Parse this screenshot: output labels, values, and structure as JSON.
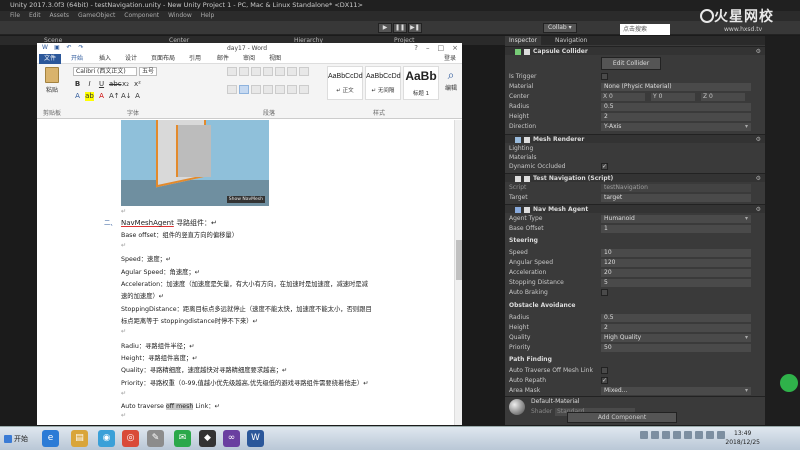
{
  "unity": {
    "title": "Unity 2017.3.0f3 (64bit) - testNavigation.unity - New Unity Project 1 - PC, Mac & Linux Standalone* <DX11>",
    "menu": [
      "File",
      "Edit",
      "Assets",
      "GameObject",
      "Component",
      "Window",
      "Help"
    ],
    "collab": "Collab ▾",
    "tabs": {
      "scene": "Scene",
      "hierarchy": "Hierarchy",
      "project": "Project",
      "center": "Center"
    },
    "search_overlay": "点击搜索"
  },
  "watermark": {
    "title": "火星网校",
    "url": "www.hxsd.tv"
  },
  "word": {
    "doc_title": "day17 - Word",
    "ribbon_tabs": [
      "文件",
      "开始",
      "插入",
      "设计",
      "页面布局",
      "引用",
      "邮件",
      "审阅",
      "视图"
    ],
    "login": "登录",
    "paste": "粘贴",
    "clipboard": "剪贴板",
    "font_name": "Calibri (西文正文)",
    "font_size": "五号",
    "font_group": "字体",
    "para_group": "段落",
    "styles_group": "样式",
    "styles": [
      {
        "sample": "AaBbCcDd",
        "name": "↵ 正文"
      },
      {
        "sample": "AaBbCcDd",
        "name": "↵ 无间隔"
      },
      {
        "sample": "AaBb",
        "name": "标题 1"
      }
    ],
    "edit": "编辑",
    "shot_label": "Show NavMesh",
    "lines": {
      "heading_num": "二、",
      "heading": "NavMeshAgent",
      "heading_rest": "寻路组件：↵",
      "base_offset": "Base offset：组件的竖直方向的偏移量）",
      "blank1": "↵",
      "speed": "Speed：速度；↵",
      "angular": "Agular Speed：角速度；↵",
      "accel1": "Acceleration：加速度（加速度是矢量，有大小有方向，在加速时是加速度，减速时是减",
      "accel2": "速的加速度）↵",
      "stop1": "StoppingDistance：距离目标点多远就停止（速度不能太快，加速度不能太小，否则跟目",
      "stop2": "标点距离等于 stoppingdistance时停不下来）↵",
      "blank2": "↵",
      "radius": "Radiu：寻路组件半径；↵",
      "height": "Height：寻路组件高度；↵",
      "quality": "Quality：寻路精细度，速度越快对寻路精细度要求越高；↵",
      "priority": "Priority：寻路权重（0-99,值越小优先级越高,优先级低的避戏寻路组件需要绕着他走）↵",
      "blank3": "↵",
      "auto_pre": "Auto traverse ",
      "auto_hl": "off mesh",
      "auto_post": " Link：↵",
      "blank4": "↵",
      "blank5": "↵"
    }
  },
  "inspector": {
    "tabs": [
      "Inspector",
      "Navigation"
    ],
    "capsule": {
      "header": "Capsule Collider",
      "edit_collider": "Edit Collider",
      "props": [
        {
          "label": "Is Trigger",
          "type": "check",
          "value": ""
        },
        {
          "label": "Material",
          "type": "field",
          "value": "None (Physic Material)"
        },
        {
          "label": "Radius",
          "type": "field",
          "value": "0.5"
        },
        {
          "label": "Height",
          "type": "field",
          "value": "2"
        },
        {
          "label": "Direction",
          "type": "dd",
          "value": "Y-Axis"
        }
      ],
      "center_label": "Center",
      "center": [
        "X 0",
        "Y 0",
        "Z 0"
      ]
    },
    "mesh_renderer": {
      "header": "Mesh Renderer",
      "lighting": "Lighting",
      "materials": "Materials",
      "occluded": "Dynamic Occluded",
      "occluded_check": "✓"
    },
    "test_nav": {
      "header": "Test Navigation (Script)",
      "script_label": "Script",
      "script_value": "testNavigation",
      "target_label": "Target",
      "target_value": "target"
    },
    "nav_agent": {
      "header": "Nav Mesh Agent",
      "agent_type_label": "Agent Type",
      "agent_type": "Humanoid",
      "base_offset_label": "Base Offset",
      "base_offset": "1",
      "steering": "Steering",
      "speed_label": "Speed",
      "speed": "10",
      "angular_label": "Angular Speed",
      "angular": "120",
      "accel_label": "Acceleration",
      "accel": "20",
      "stop_label": "Stopping Distance",
      "stop": "5",
      "braking_label": "Auto Braking",
      "braking": "",
      "obstacle": "Obstacle Avoidance",
      "radius_label": "Radius",
      "radius": "0.5",
      "height_label": "Height",
      "height": "2",
      "quality_label": "Quality",
      "quality": "High Quality",
      "priority_label": "Priority",
      "priority": "50",
      "pathfinding": "Path Finding",
      "traverse_label": "Auto Traverse Off Mesh Link",
      "traverse": "",
      "repath_label": "Auto Repath",
      "repath": "✓",
      "area_label": "Area Mask",
      "area": "Mixed..."
    },
    "material": {
      "name": "Default-Material",
      "shader_label": "Shader",
      "shader": "Standard"
    },
    "add_component": "Add Component"
  },
  "taskbar": {
    "start": "开始",
    "apps": [
      {
        "icon": "ie-icon",
        "glyph": "e",
        "color": "#2b7bd6"
      },
      {
        "icon": "folder-icon",
        "glyph": "▤",
        "color": "#d9a53a"
      },
      {
        "icon": "qq-icon",
        "glyph": "◉",
        "color": "#3aa0d8"
      },
      {
        "icon": "chrome-icon",
        "glyph": "◎",
        "color": "#d94a38"
      },
      {
        "icon": "tools-icon",
        "glyph": "✎",
        "color": "#8c8c8c"
      },
      {
        "icon": "wechat-icon",
        "glyph": "✉",
        "color": "#2ba84a"
      },
      {
        "icon": "unity-icon",
        "glyph": "◆",
        "color": "#333333"
      },
      {
        "icon": "visualstudio-icon",
        "glyph": "∞",
        "color": "#6a3fa0"
      },
      {
        "icon": "word-icon",
        "glyph": "W",
        "color": "#2b579a"
      }
    ],
    "time": "13:49",
    "date": "2018/12/25"
  }
}
